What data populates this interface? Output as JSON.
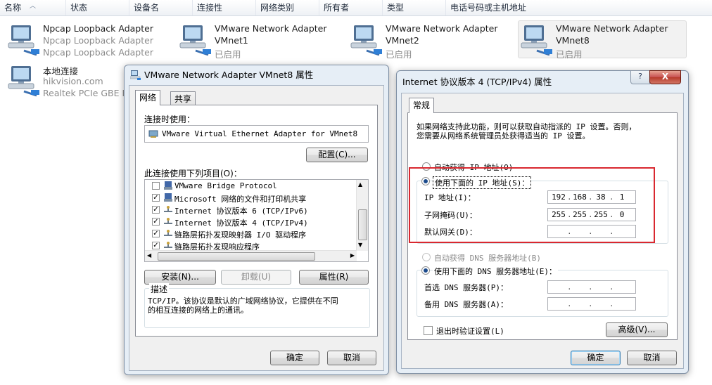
{
  "header": {
    "columns": [
      "名称",
      "状态",
      "设备名",
      "连接性",
      "网络类别",
      "所有者",
      "类型",
      "电话号码或主机地址"
    ]
  },
  "adapters": [
    {
      "name": "Npcap Loopback Adapter",
      "line2": "Npcap Loopback Adapter",
      "line3": "Npcap Loopback Adapter"
    },
    {
      "name": "VMware Network Adapter",
      "line2": "VMnet1",
      "line3": "已启用"
    },
    {
      "name": "VMware Network Adapter",
      "line2": "VMnet2",
      "line3": "已启用"
    },
    {
      "name": "VMware Network Adapter",
      "line2": "VMnet8",
      "line3": "已启用"
    },
    {
      "name": "本地连接",
      "line2": "hikvision.com",
      "line3": "Realtek PCIe GBE Fa"
    }
  ],
  "props": {
    "title": "VMware Network Adapter VMnet8 属性",
    "tabs": [
      "网络",
      "共享"
    ],
    "connect_using_label": "连接时使用：",
    "adapter_name": "VMware Virtual Ethernet Adapter for VMnet8",
    "configure_btn": "配置(C)...",
    "items_label": "此连接使用下列项目(O)：",
    "items": [
      {
        "text": "VMware Bridge Protocol",
        "checked": false
      },
      {
        "text": "Microsoft 网络的文件和打印机共享",
        "checked": true
      },
      {
        "text": "Internet 协议版本 6 (TCP/IPv6)",
        "checked": true
      },
      {
        "text": "Internet 协议版本 4 (TCP/IPv4)",
        "checked": true
      },
      {
        "text": "链路层拓扑发现映射器 I/O 驱动程序",
        "checked": true
      },
      {
        "text": "链路层拓扑发现响应程序",
        "checked": true
      }
    ],
    "install_btn": "安装(N)...",
    "uninstall_btn": "卸载(U)",
    "properties_btn": "属性(R)",
    "desc_caption": "描述",
    "desc_text_1": "TCP/IP。该协议是默认的广域网络协议，它提供在不同",
    "desc_text_2": "的相互连接的网络上的通讯。",
    "ok_btn": "确定",
    "cancel_btn": "取消"
  },
  "ipv4": {
    "title": "Internet 协议版本 4 (TCP/IPv4) 属性",
    "help_glyph": "?",
    "close_glyph": "X",
    "tab": "常规",
    "intro_1": "如果网络支持此功能，则可以获取自动指派的 IP 设置。否则，",
    "intro_2": "您需要从网络系统管理员处获得适当的 IP 设置。",
    "auto_ip": "自动获得 IP 地址(O)",
    "manual_ip": "使用下面的 IP 地址(S)：",
    "ip_label": "IP 地址(I)：",
    "mask_label": "子网掩码(U)：",
    "gateway_label": "默认网关(D)：",
    "ip": [
      "192",
      "168",
      "38",
      "1"
    ],
    "mask": [
      "255",
      "255",
      "255",
      "0"
    ],
    "auto_dns": "自动获得 DNS 服务器地址(B)",
    "manual_dns": "使用下面的 DNS 服务器地址(E)：",
    "dns1_label": "首选 DNS 服务器(P)：",
    "dns2_label": "备用 DNS 服务器(A)：",
    "validate_label": "退出时验证设置(L)",
    "advanced_btn": "高级(V)...",
    "ok_btn": "确定",
    "cancel_btn": "取消"
  },
  "colors": {
    "highlight_box": "#d9282f",
    "window_frame": "#e6eef6"
  }
}
